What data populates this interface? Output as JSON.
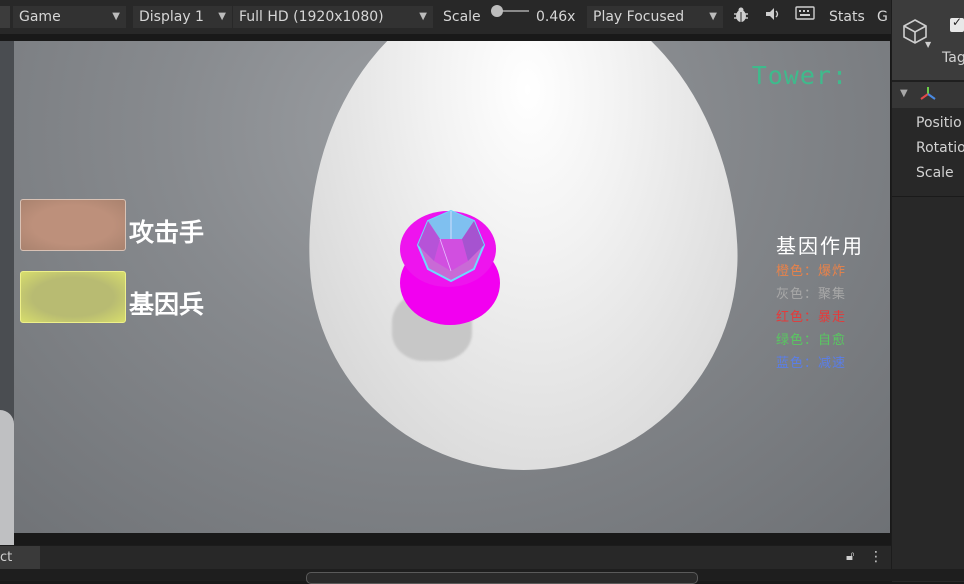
{
  "toolbar": {
    "game_label": "Game",
    "display_label": "Display 1",
    "resolution_label": "Full HD (1920x1080)",
    "scale_label": "Scale",
    "scale_value": "0.46x",
    "play_mode_label": "Play Focused",
    "stats_label": "Stats",
    "gizmos_label": "G",
    "bug_icon": "bug-icon",
    "audio_icon": "speaker-icon",
    "keyboard_icon": "keyboard-icon"
  },
  "game": {
    "tower_label": "Tower:",
    "attack_button_label": "攻击手",
    "gene_button_label": "基因兵",
    "legend": {
      "title": "基因作用",
      "rows": [
        {
          "text": "橙色：爆炸",
          "color": "#e8824a"
        },
        {
          "text": "灰色：聚集",
          "color": "#a8a8a8"
        },
        {
          "text": "红色：暴走",
          "color": "#e53a3a"
        },
        {
          "text": "绿色：自愈",
          "color": "#58c860"
        },
        {
          "text": "蓝色：减速",
          "color": "#5a7ee8"
        }
      ]
    }
  },
  "inspector": {
    "tag_label": "Tag",
    "position_label": "Positio",
    "rotation_label": "Rotatio",
    "scale_label": "Scale"
  },
  "bottom": {
    "tab_label": "ct"
  }
}
